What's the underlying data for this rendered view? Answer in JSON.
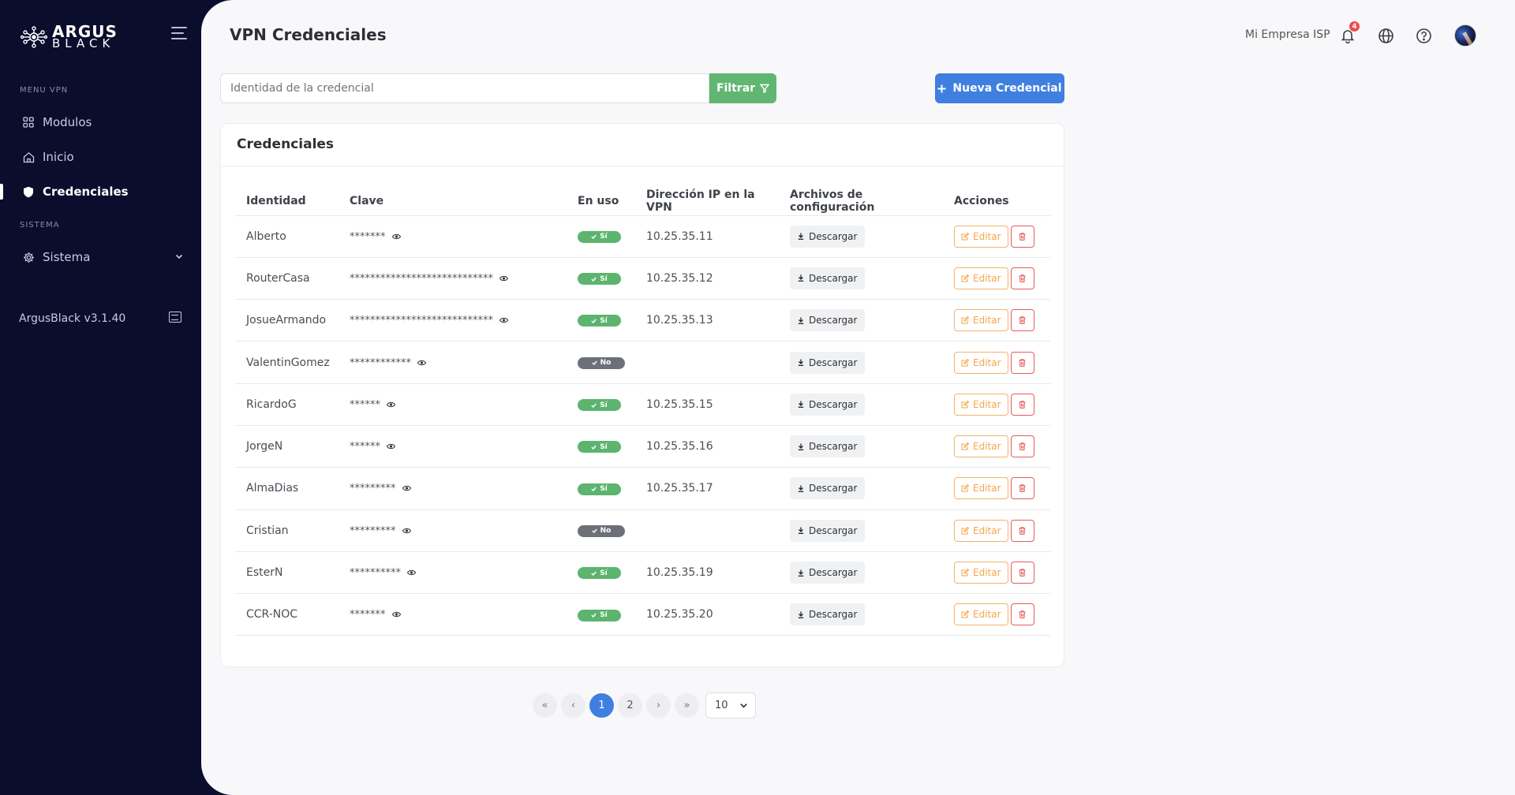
{
  "brand": {
    "line1": "ARGUS",
    "line2": "BLACK"
  },
  "sidebar": {
    "section_vpn": "MENU VPN",
    "section_system": "SISTEMA",
    "items": [
      {
        "label": "Modulos",
        "icon": "grid-icon"
      },
      {
        "label": "Inicio",
        "icon": "home-icon"
      },
      {
        "label": "Credenciales",
        "icon": "shield-icon",
        "active": true
      },
      {
        "label": "Sistema",
        "icon": "gear-icon"
      }
    ],
    "version": "ArgusBlack v3.1.40"
  },
  "header": {
    "title": "VPN Credenciales",
    "company": "Mi Empresa ISP",
    "notifications": "4"
  },
  "toolbar": {
    "search_placeholder": "Identidad de la credencial",
    "filter_label": "Filtrar",
    "new_label": "Nueva Credencial"
  },
  "card": {
    "title": "Credenciales"
  },
  "table": {
    "headers": [
      "Identidad",
      "Clave",
      "En uso",
      "Dirección IP en la VPN",
      "Archivos de configuración",
      "Acciones"
    ],
    "download_label": "Descargar",
    "edit_label": "Editar",
    "rows": [
      {
        "identity": "Alberto",
        "key": "*******",
        "in_use": "Sí",
        "ip": "10.25.35.11"
      },
      {
        "identity": "RouterCasa",
        "key": "****************************",
        "in_use": "Sí",
        "ip": "10.25.35.12"
      },
      {
        "identity": "JosueArmando",
        "key": "****************************",
        "in_use": "Sí",
        "ip": "10.25.35.13"
      },
      {
        "identity": "ValentinGomez",
        "key": "************",
        "in_use": "No",
        "ip": ""
      },
      {
        "identity": "RicardoG",
        "key": "******",
        "in_use": "Sí",
        "ip": "10.25.35.15"
      },
      {
        "identity": "JorgeN",
        "key": "******",
        "in_use": "Sí",
        "ip": "10.25.35.16"
      },
      {
        "identity": "AlmaDias",
        "key": "*********",
        "in_use": "Sí",
        "ip": "10.25.35.17"
      },
      {
        "identity": "Cristian",
        "key": "*********",
        "in_use": "No",
        "ip": ""
      },
      {
        "identity": "EsterN",
        "key": "**********",
        "in_use": "Sí",
        "ip": "10.25.35.19"
      },
      {
        "identity": "CCR-NOC",
        "key": "*******",
        "in_use": "Sí",
        "ip": "10.25.35.20"
      }
    ]
  },
  "pagination": {
    "first": "«",
    "prev": "‹",
    "pages": [
      "1",
      "2"
    ],
    "current": "1",
    "next": "›",
    "last": "»",
    "page_size": "10"
  },
  "colors": {
    "sidebar_bg": "#0b0d2c",
    "primary": "#3f7fe0",
    "success": "#61b672",
    "warning": "#f4a54a",
    "danger": "#e85b5b"
  }
}
